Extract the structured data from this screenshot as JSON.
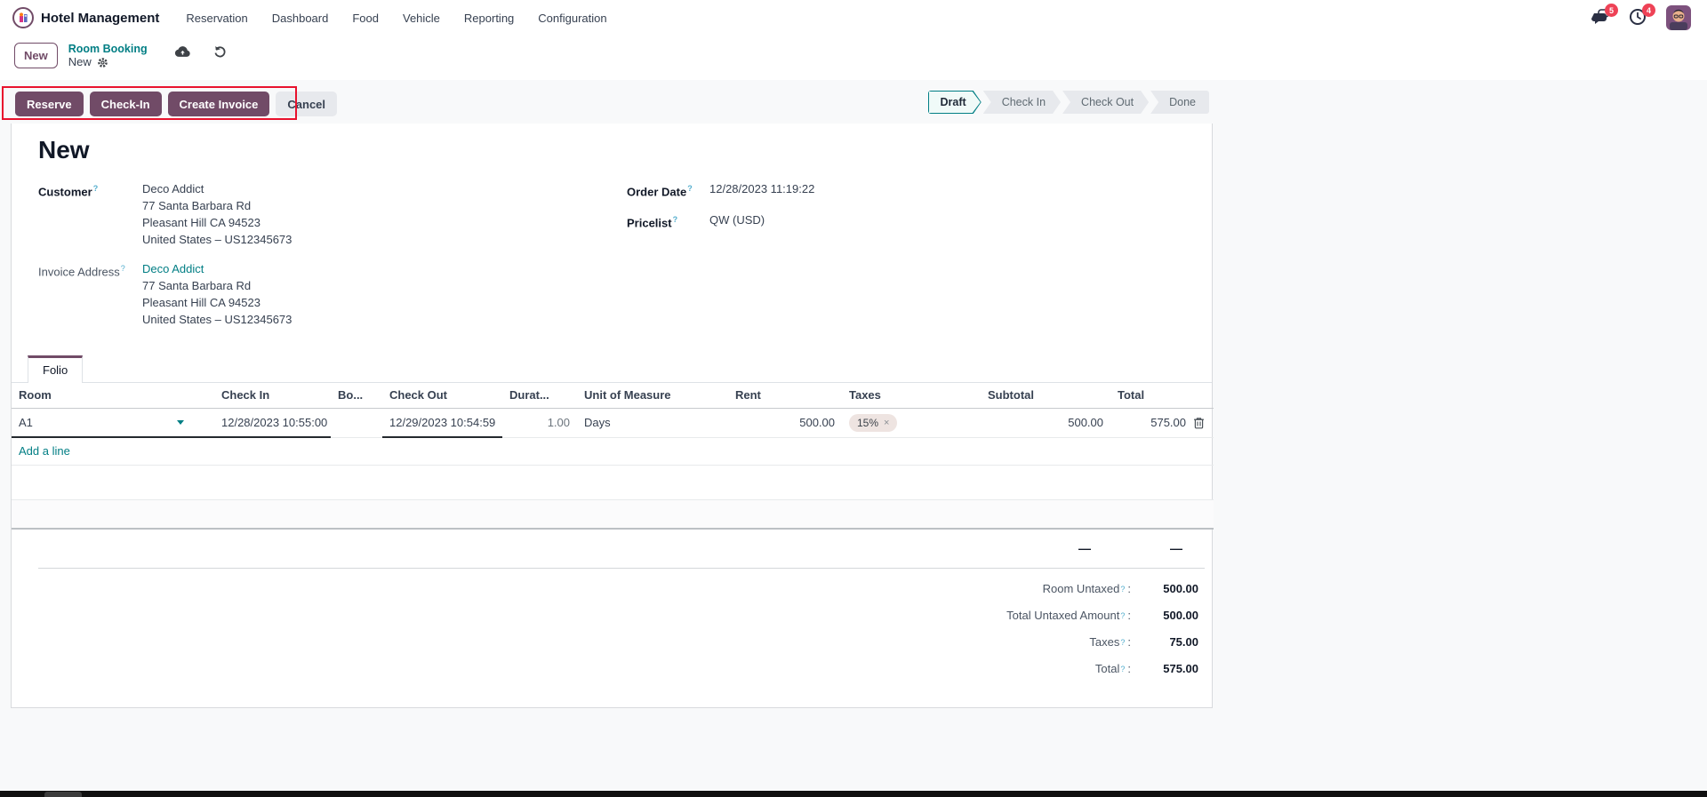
{
  "ui": {
    "help_marker": "?",
    "colon": ":"
  },
  "colors": {
    "accent_purple": "#714B67",
    "link_teal": "#017E84",
    "badge_red": "#ee4256",
    "annotation_red": "#e8112d",
    "step_active_border": "#017E84",
    "tag_bg": "#eee4e1",
    "page_bg": "#f8f9fa"
  },
  "navbar": {
    "app_name": "Hotel Management",
    "items": [
      "Reservation",
      "Dashboard",
      "Food",
      "Vehicle",
      "Reporting",
      "Configuration"
    ],
    "messages_badge": "5",
    "activities_badge": "4"
  },
  "breadcrumb": {
    "new_button": "New",
    "parent": "Room Booking",
    "current": "New"
  },
  "actions": {
    "reserve": "Reserve",
    "check_in": "Check-In",
    "create_invoice": "Create Invoice",
    "cancel": "Cancel"
  },
  "statusbar": {
    "steps": [
      {
        "label": "Draft",
        "active": true
      },
      {
        "label": "Check In",
        "active": false
      },
      {
        "label": "Check Out",
        "active": false
      },
      {
        "label": "Done",
        "active": false
      }
    ]
  },
  "form": {
    "title": "New",
    "customer": {
      "label": "Customer",
      "name": "Deco Addict",
      "address": [
        "77 Santa Barbara Rd",
        "Pleasant Hill CA 94523",
        "United States – US12345673"
      ]
    },
    "invoice_address": {
      "label": "Invoice Address",
      "name": "Deco Addict",
      "address": [
        "77 Santa Barbara Rd",
        "Pleasant Hill CA 94523",
        "United States – US12345673"
      ]
    },
    "order_date": {
      "label": "Order Date",
      "value": "12/28/2023 11:19:22"
    },
    "pricelist": {
      "label": "Pricelist",
      "value": "QW (USD)"
    },
    "tab": {
      "label": "Folio"
    }
  },
  "folio_table": {
    "headers": {
      "room": "Room",
      "check_in": "Check In",
      "booking": "Bo...",
      "check_out": "Check Out",
      "duration": "Durat...",
      "uom": "Unit of Measure",
      "rent": "Rent",
      "taxes": "Taxes",
      "subtotal": "Subtotal",
      "total": "Total"
    },
    "rows": [
      {
        "room": "A1",
        "check_in": "12/28/2023 10:55:00",
        "check_out": "12/29/2023 10:54:59",
        "duration": "1.00",
        "uom": "Days",
        "rent": "500.00",
        "tax": "15%",
        "tax_remove": "×",
        "subtotal": "500.00",
        "total": "575.00"
      }
    ],
    "add_line_label": "Add a line"
  },
  "totals": {
    "placeholder_dash": "—",
    "rows": [
      {
        "label": "Room Untaxed",
        "value": "500.00"
      },
      {
        "label": "Total Untaxed Amount",
        "value": "500.00"
      },
      {
        "label": "Taxes",
        "value": "75.00"
      },
      {
        "label": "Total",
        "value": "575.00"
      }
    ]
  }
}
